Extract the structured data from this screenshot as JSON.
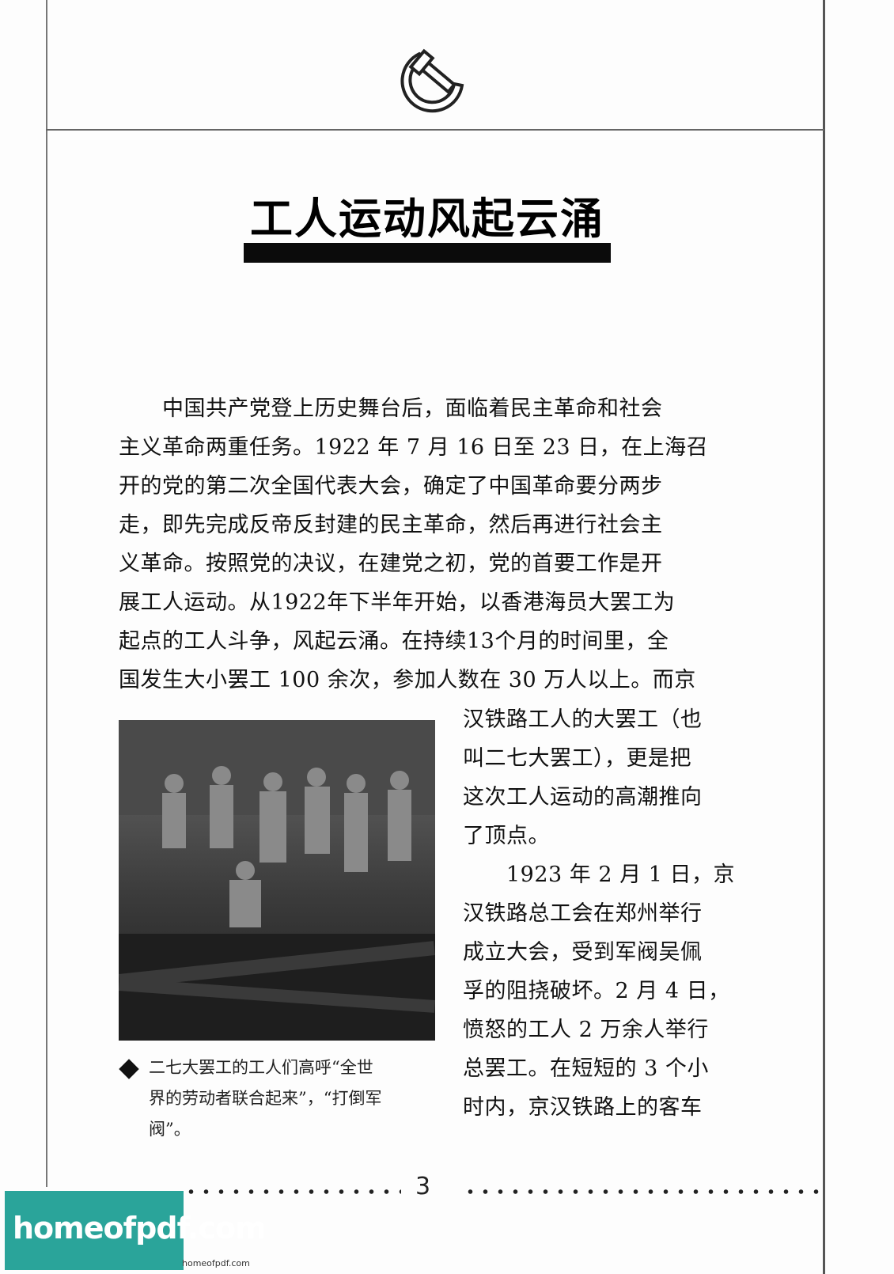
{
  "title": "工人运动风起云涌",
  "paragraph_lines": [
    "　　中国共产党登上历史舞台后，面临着民主革命和社会",
    "主义革命两重任务。1922 年 7 月 16 日至 23 日，在上海召",
    "开的党的第二次全国代表大会，确定了中国革命要分两步",
    "走，即先完成反帝反封建的民主革命，然后再进行社会主",
    "义革命。按照党的决议，在建党之初，党的首要工作是开",
    "展工人运动。从1922年下半年开始，以香港海员大罢工为",
    "起点的工人斗争，风起云涌。在持续13个月的时间里，全",
    "国发生大小罢工 100 余次，参加人数在 30 万人以上。而京"
  ],
  "right_column_lines": [
    "汉铁路工人的大罢工（也",
    "叫二七大罢工），更是把",
    "这次工人运动的高潮推向",
    "了顶点。",
    "　　1923 年 2 月 1 日，京",
    "汉铁路总工会在郑州举行",
    "成立大会，受到军阀吴佩",
    "孚的阻挠破坏。2 月 4 日，",
    "愤怒的工人 2 万余人举行",
    "总罢工。在短短的 3 个小",
    "时内，京汉铁路上的客车"
  ],
  "caption_lines": [
    "二七大罢工的工人们高呼“全世",
    "界的劳动者联合起来”，“打倒军",
    "阀”。"
  ],
  "page_number": "3",
  "watermark": {
    "text": "homeofpdf.com",
    "small_text": "homeofpdf.com",
    "color": "#2aa49a"
  }
}
